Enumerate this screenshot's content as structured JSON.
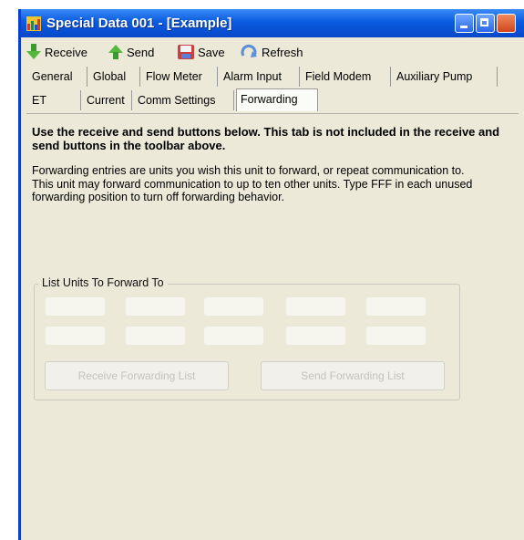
{
  "window": {
    "title": "Special Data 001 - [Example]"
  },
  "toolbar": {
    "receive": "Receive",
    "send": "Send",
    "save": "Save",
    "refresh": "Refresh"
  },
  "tabs": {
    "row1": [
      "General",
      "Global",
      "Flow Meter",
      "Alarm Input",
      "Field Modem",
      "Auxiliary Pump"
    ],
    "row2": [
      "ET",
      "Current",
      "Comm Settings",
      "Forwarding"
    ],
    "active": "Forwarding"
  },
  "forwarding": {
    "heading": "Use the receive and send buttons below.  This tab is not included in the receive and send buttons in the toolbar above.",
    "description": "Forwarding entries are units you wish this unit to forward, or repeat communication to.  This unit may forward communication to up to ten other units.  Type FFF in each unused forwarding position to turn off forwarding behavior.",
    "group_label": "List Units To Forward To",
    "receive_button": "Receive Forwarding List",
    "send_button": "Send Forwarding List"
  }
}
